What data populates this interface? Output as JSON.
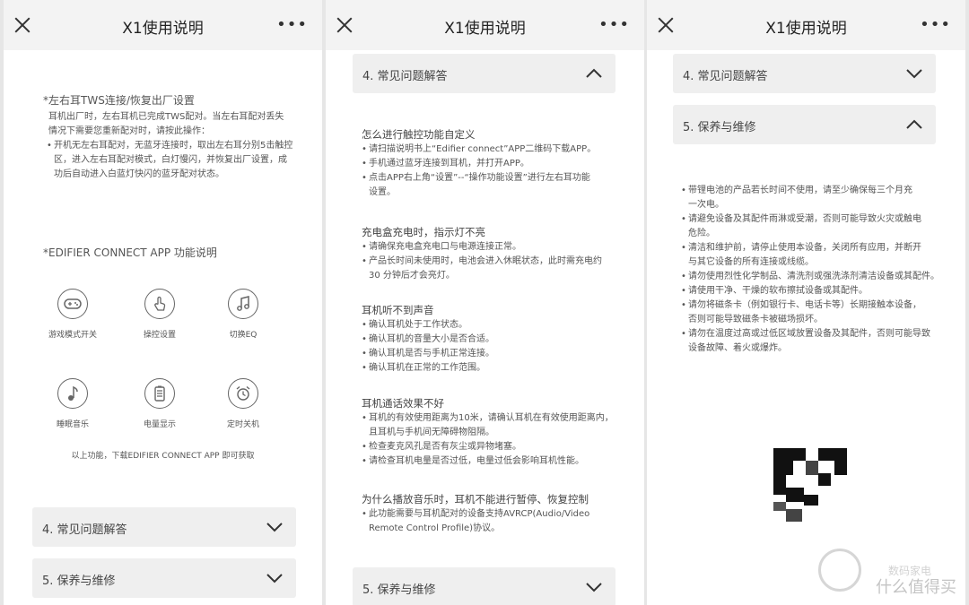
{
  "header": {
    "title": "X1使用说明",
    "more": "•••"
  },
  "panel1": {
    "tws_title": "*左右耳TWS连接/恢复出厂设置",
    "tws_para": [
      "耳机出厂时，左右耳机已完成TWS配对。当左右耳配对丢失",
      "情况下需要您重新配对时，请按此操作："
    ],
    "tws_bullet": [
      "开机无左右耳配对，无蓝牙连接时，取出左右耳分别5击触控",
      "区，进入左右耳配对模式，白灯慢闪，并恢复出厂设置，成",
      "功后自动进入白蓝灯快闪的蓝牙配对状态。"
    ],
    "app_title": "*EDIFIER CONNECT APP 功能说明",
    "icons": [
      {
        "label": "游戏模式开关",
        "icon": "gamepad-icon"
      },
      {
        "label": "操控设置",
        "icon": "touch-icon"
      },
      {
        "label": "切换EQ",
        "icon": "music-note-icon"
      },
      {
        "label": "睡眠音乐",
        "icon": "note-icon"
      },
      {
        "label": "电量显示",
        "icon": "battery-icon"
      },
      {
        "label": "定时关机",
        "icon": "alarm-icon"
      }
    ],
    "app_note": "以上功能，下载EDIFIER CONNECT APP 即可获取",
    "acc1": "4. 常见问题解答",
    "acc2": "5. 保养与维修"
  },
  "panel2": {
    "acc_open": "4. 常见问题解答",
    "q1": {
      "title": "怎么进行触控功能自定义",
      "bullets": [
        [
          "请扫描说明书上“Edifier connect”APP二维码下载APP。"
        ],
        [
          "手机通过蓝牙连接到耳机，并打开APP。"
        ],
        [
          "点击APP右上角“设置”--“操作功能设置”进行左右耳功能",
          "设置。"
        ]
      ]
    },
    "q2": {
      "title": "充电盒充电时，指示灯不亮",
      "bullets": [
        [
          "请确保充电盒充电口与电源连接正常。"
        ],
        [
          "产品长时间未使用时，电池会进入休眠状态，此时需充电约",
          "30 分钟后才会亮灯。"
        ]
      ]
    },
    "q3": {
      "title": "耳机听不到声音",
      "bullets": [
        [
          "确认耳机处于工作状态。"
        ],
        [
          "确认耳机的音量大小是否合适。"
        ],
        [
          "确认耳机是否与手机正常连接。"
        ],
        [
          "确认耳机在正常的工作范围。"
        ]
      ]
    },
    "q4": {
      "title": "耳机通话效果不好",
      "bullets": [
        [
          "耳机的有效使用距离为10米，请确认耳机在有效使用距离内，",
          "且耳机与手机间无障碍物阻隔。"
        ],
        [
          "检查麦克风孔是否有灰尘或异物堵塞。"
        ],
        [
          "请检查耳机电量是否过低，电量过低会影响耳机性能。"
        ]
      ]
    },
    "q5": {
      "title": "为什么播放音乐时，耳机不能进行暂停、恢复控制",
      "bullets": [
        [
          "此功能需要与耳机配对的设备支持AVRCP(Audio/Video",
          "Remote Control Profile)协议。"
        ]
      ]
    },
    "acc_bottom": "5. 保养与维修"
  },
  "panel3": {
    "acc1": "4. 常见问题解答",
    "acc2": "5. 保养与维修",
    "bullets": [
      [
        "带锂电池的产品若长时间不使用，请至少确保每三个月充",
        "一次电。"
      ],
      [
        "请避免设备及其配件雨淋或受潮，否则可能导致火灾或触电",
        "危险。"
      ],
      [
        "清洁和维护前，请停止使用本设备，关闭所有应用，并断开",
        "与其它设备的所有连接或线缆。"
      ],
      [
        "请勿使用烈性化学制品、清洗剂或强洗涤剂清洁设备或其配件。"
      ],
      [
        "请使用干净、干燥的软布擦拭设备或其配件。"
      ],
      [
        "请勿将磁条卡（例如银行卡、电话卡等）长期接触本设备，",
        "否则可能导致磁条卡被磁场损坏。"
      ],
      [
        "请勿在温度过高或过低区域放置设备及其配件，否则可能导致",
        "设备故障、着火或爆炸。"
      ]
    ],
    "watermark_top": "数码家电",
    "watermark": "什么值得买"
  }
}
